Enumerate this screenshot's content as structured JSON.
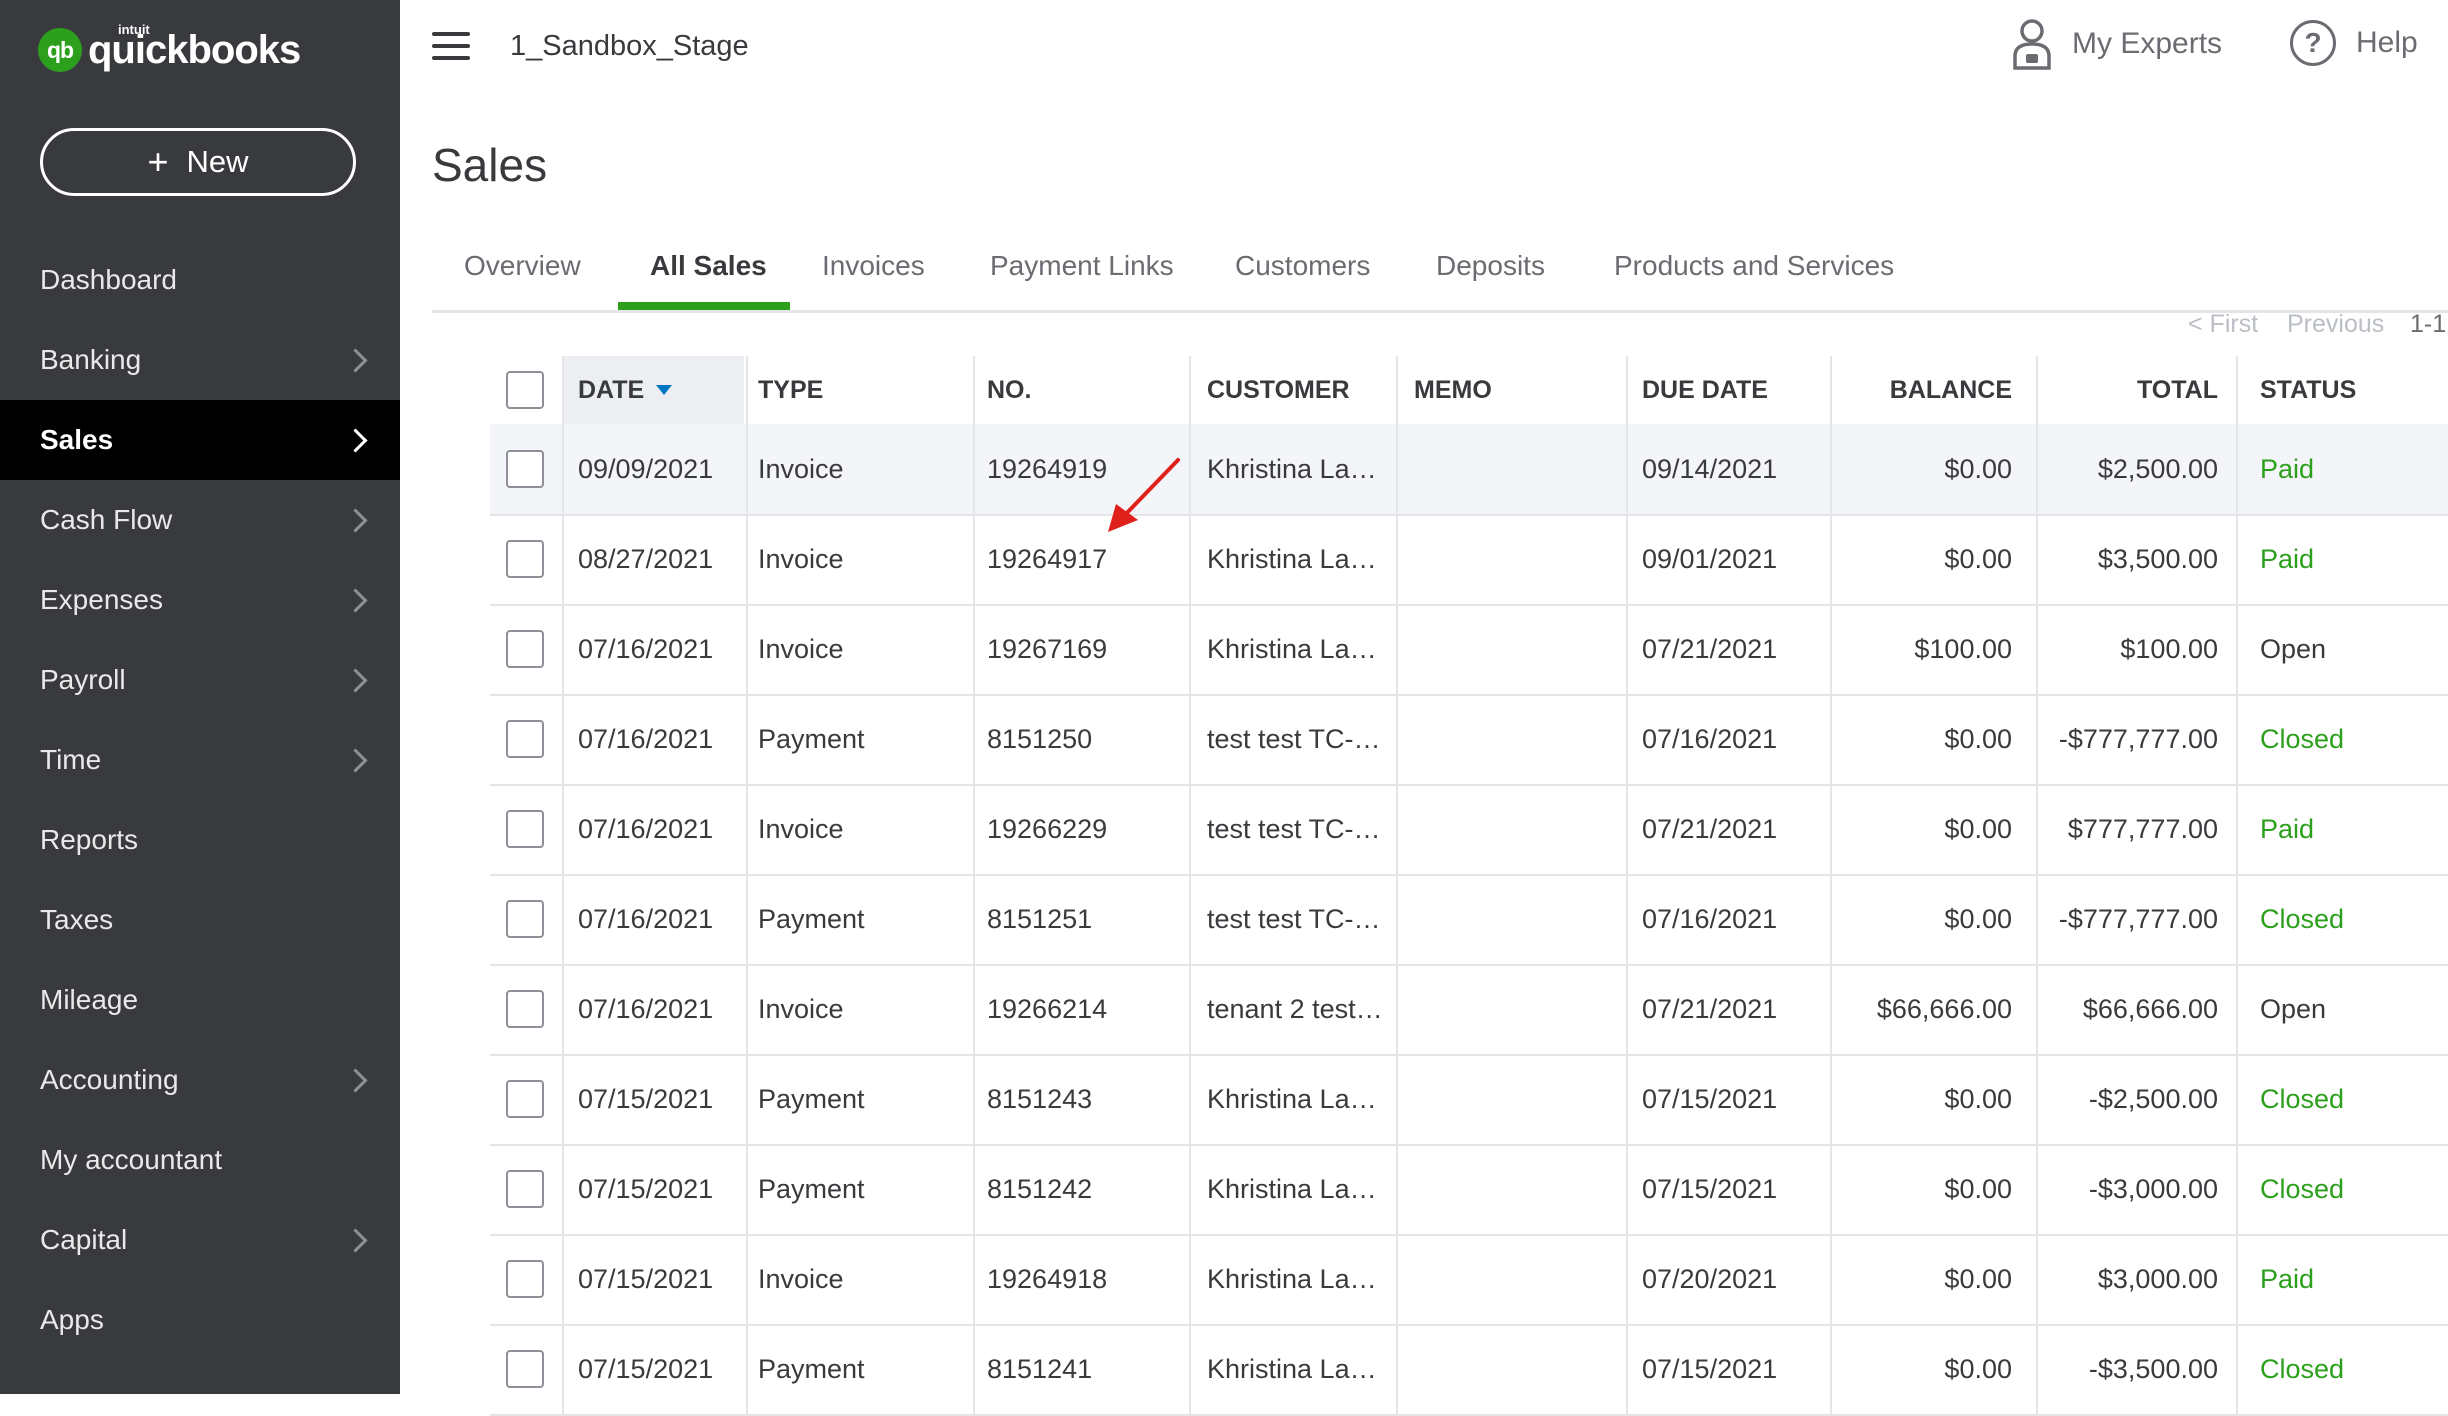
{
  "app": {
    "logo_small": "intuit",
    "logo_word": "quickbooks",
    "logo_mark": "qb",
    "company": "1_Sandbox_Stage",
    "my_experts": "My Experts",
    "help": "Help",
    "help_glyph": "?"
  },
  "sidebar": {
    "new_label": "New",
    "new_icon": "+",
    "items": [
      {
        "label": "Dashboard",
        "has_arrow": false
      },
      {
        "label": "Banking",
        "has_arrow": true
      },
      {
        "label": "Sales",
        "has_arrow": true,
        "active": true
      },
      {
        "label": "Cash Flow",
        "has_arrow": true
      },
      {
        "label": "Expenses",
        "has_arrow": true
      },
      {
        "label": "Payroll",
        "has_arrow": true
      },
      {
        "label": "Time",
        "has_arrow": true
      },
      {
        "label": "Reports",
        "has_arrow": false
      },
      {
        "label": "Taxes",
        "has_arrow": false
      },
      {
        "label": "Mileage",
        "has_arrow": false
      },
      {
        "label": "Accounting",
        "has_arrow": true
      },
      {
        "label": "My accountant",
        "has_arrow": false
      },
      {
        "label": "Capital",
        "has_arrow": true
      },
      {
        "label": "Apps",
        "has_arrow": false
      }
    ]
  },
  "page": {
    "title": "Sales",
    "tabs": [
      "Overview",
      "All Sales",
      "Invoices",
      "Payment Links",
      "Customers",
      "Deposits",
      "Products and Services"
    ],
    "active_tab": "All Sales"
  },
  "pager": {
    "first": "< First",
    "previous": "Previous",
    "range": "1-1"
  },
  "table": {
    "columns": [
      "DATE",
      "TYPE",
      "NO.",
      "CUSTOMER",
      "MEMO",
      "DUE DATE",
      "BALANCE",
      "TOTAL",
      "STATUS"
    ],
    "rows": [
      {
        "date": "09/09/2021",
        "type": "Invoice",
        "no": "19264919",
        "customer": "Khristina La…",
        "memo": "",
        "due": "09/14/2021",
        "balance": "$0.00",
        "total": "$2,500.00",
        "status": "Paid"
      },
      {
        "date": "08/27/2021",
        "type": "Invoice",
        "no": "19264917",
        "customer": "Khristina La…",
        "memo": "",
        "due": "09/01/2021",
        "balance": "$0.00",
        "total": "$3,500.00",
        "status": "Paid"
      },
      {
        "date": "07/16/2021",
        "type": "Invoice",
        "no": "19267169",
        "customer": "Khristina La…",
        "memo": "",
        "due": "07/21/2021",
        "balance": "$100.00",
        "total": "$100.00",
        "status": "Open"
      },
      {
        "date": "07/16/2021",
        "type": "Payment",
        "no": "8151250",
        "customer": "test test TC-…",
        "memo": "",
        "due": "07/16/2021",
        "balance": "$0.00",
        "total": "-$777,777.00",
        "status": "Closed"
      },
      {
        "date": "07/16/2021",
        "type": "Invoice",
        "no": "19266229",
        "customer": "test test TC-…",
        "memo": "",
        "due": "07/21/2021",
        "balance": "$0.00",
        "total": "$777,777.00",
        "status": "Paid"
      },
      {
        "date": "07/16/2021",
        "type": "Payment",
        "no": "8151251",
        "customer": "test test TC-…",
        "memo": "",
        "due": "07/16/2021",
        "balance": "$0.00",
        "total": "-$777,777.00",
        "status": "Closed"
      },
      {
        "date": "07/16/2021",
        "type": "Invoice",
        "no": "19266214",
        "customer": "tenant 2 test…",
        "memo": "",
        "due": "07/21/2021",
        "balance": "$66,666.00",
        "total": "$66,666.00",
        "status": "Open"
      },
      {
        "date": "07/15/2021",
        "type": "Payment",
        "no": "8151243",
        "customer": "Khristina La…",
        "memo": "",
        "due": "07/15/2021",
        "balance": "$0.00",
        "total": "-$2,500.00",
        "status": "Closed"
      },
      {
        "date": "07/15/2021",
        "type": "Payment",
        "no": "8151242",
        "customer": "Khristina La…",
        "memo": "",
        "due": "07/15/2021",
        "balance": "$0.00",
        "total": "-$3,000.00",
        "status": "Closed"
      },
      {
        "date": "07/15/2021",
        "type": "Invoice",
        "no": "19264918",
        "customer": "Khristina La…",
        "memo": "",
        "due": "07/20/2021",
        "balance": "$0.00",
        "total": "$3,000.00",
        "status": "Paid"
      },
      {
        "date": "07/15/2021",
        "type": "Payment",
        "no": "8151241",
        "customer": "Khristina La…",
        "memo": "",
        "due": "07/15/2021",
        "balance": "$0.00",
        "total": "-$3,500.00",
        "status": "Closed"
      }
    ]
  },
  "colors": {
    "sidebar_bg": "#393a3d",
    "brand_green": "#2ca01c",
    "status_paid": "#2ca01c",
    "status_closed": "#2ca01c",
    "status_open": "#393a3d",
    "annotation_arrow": "#e0201b"
  }
}
